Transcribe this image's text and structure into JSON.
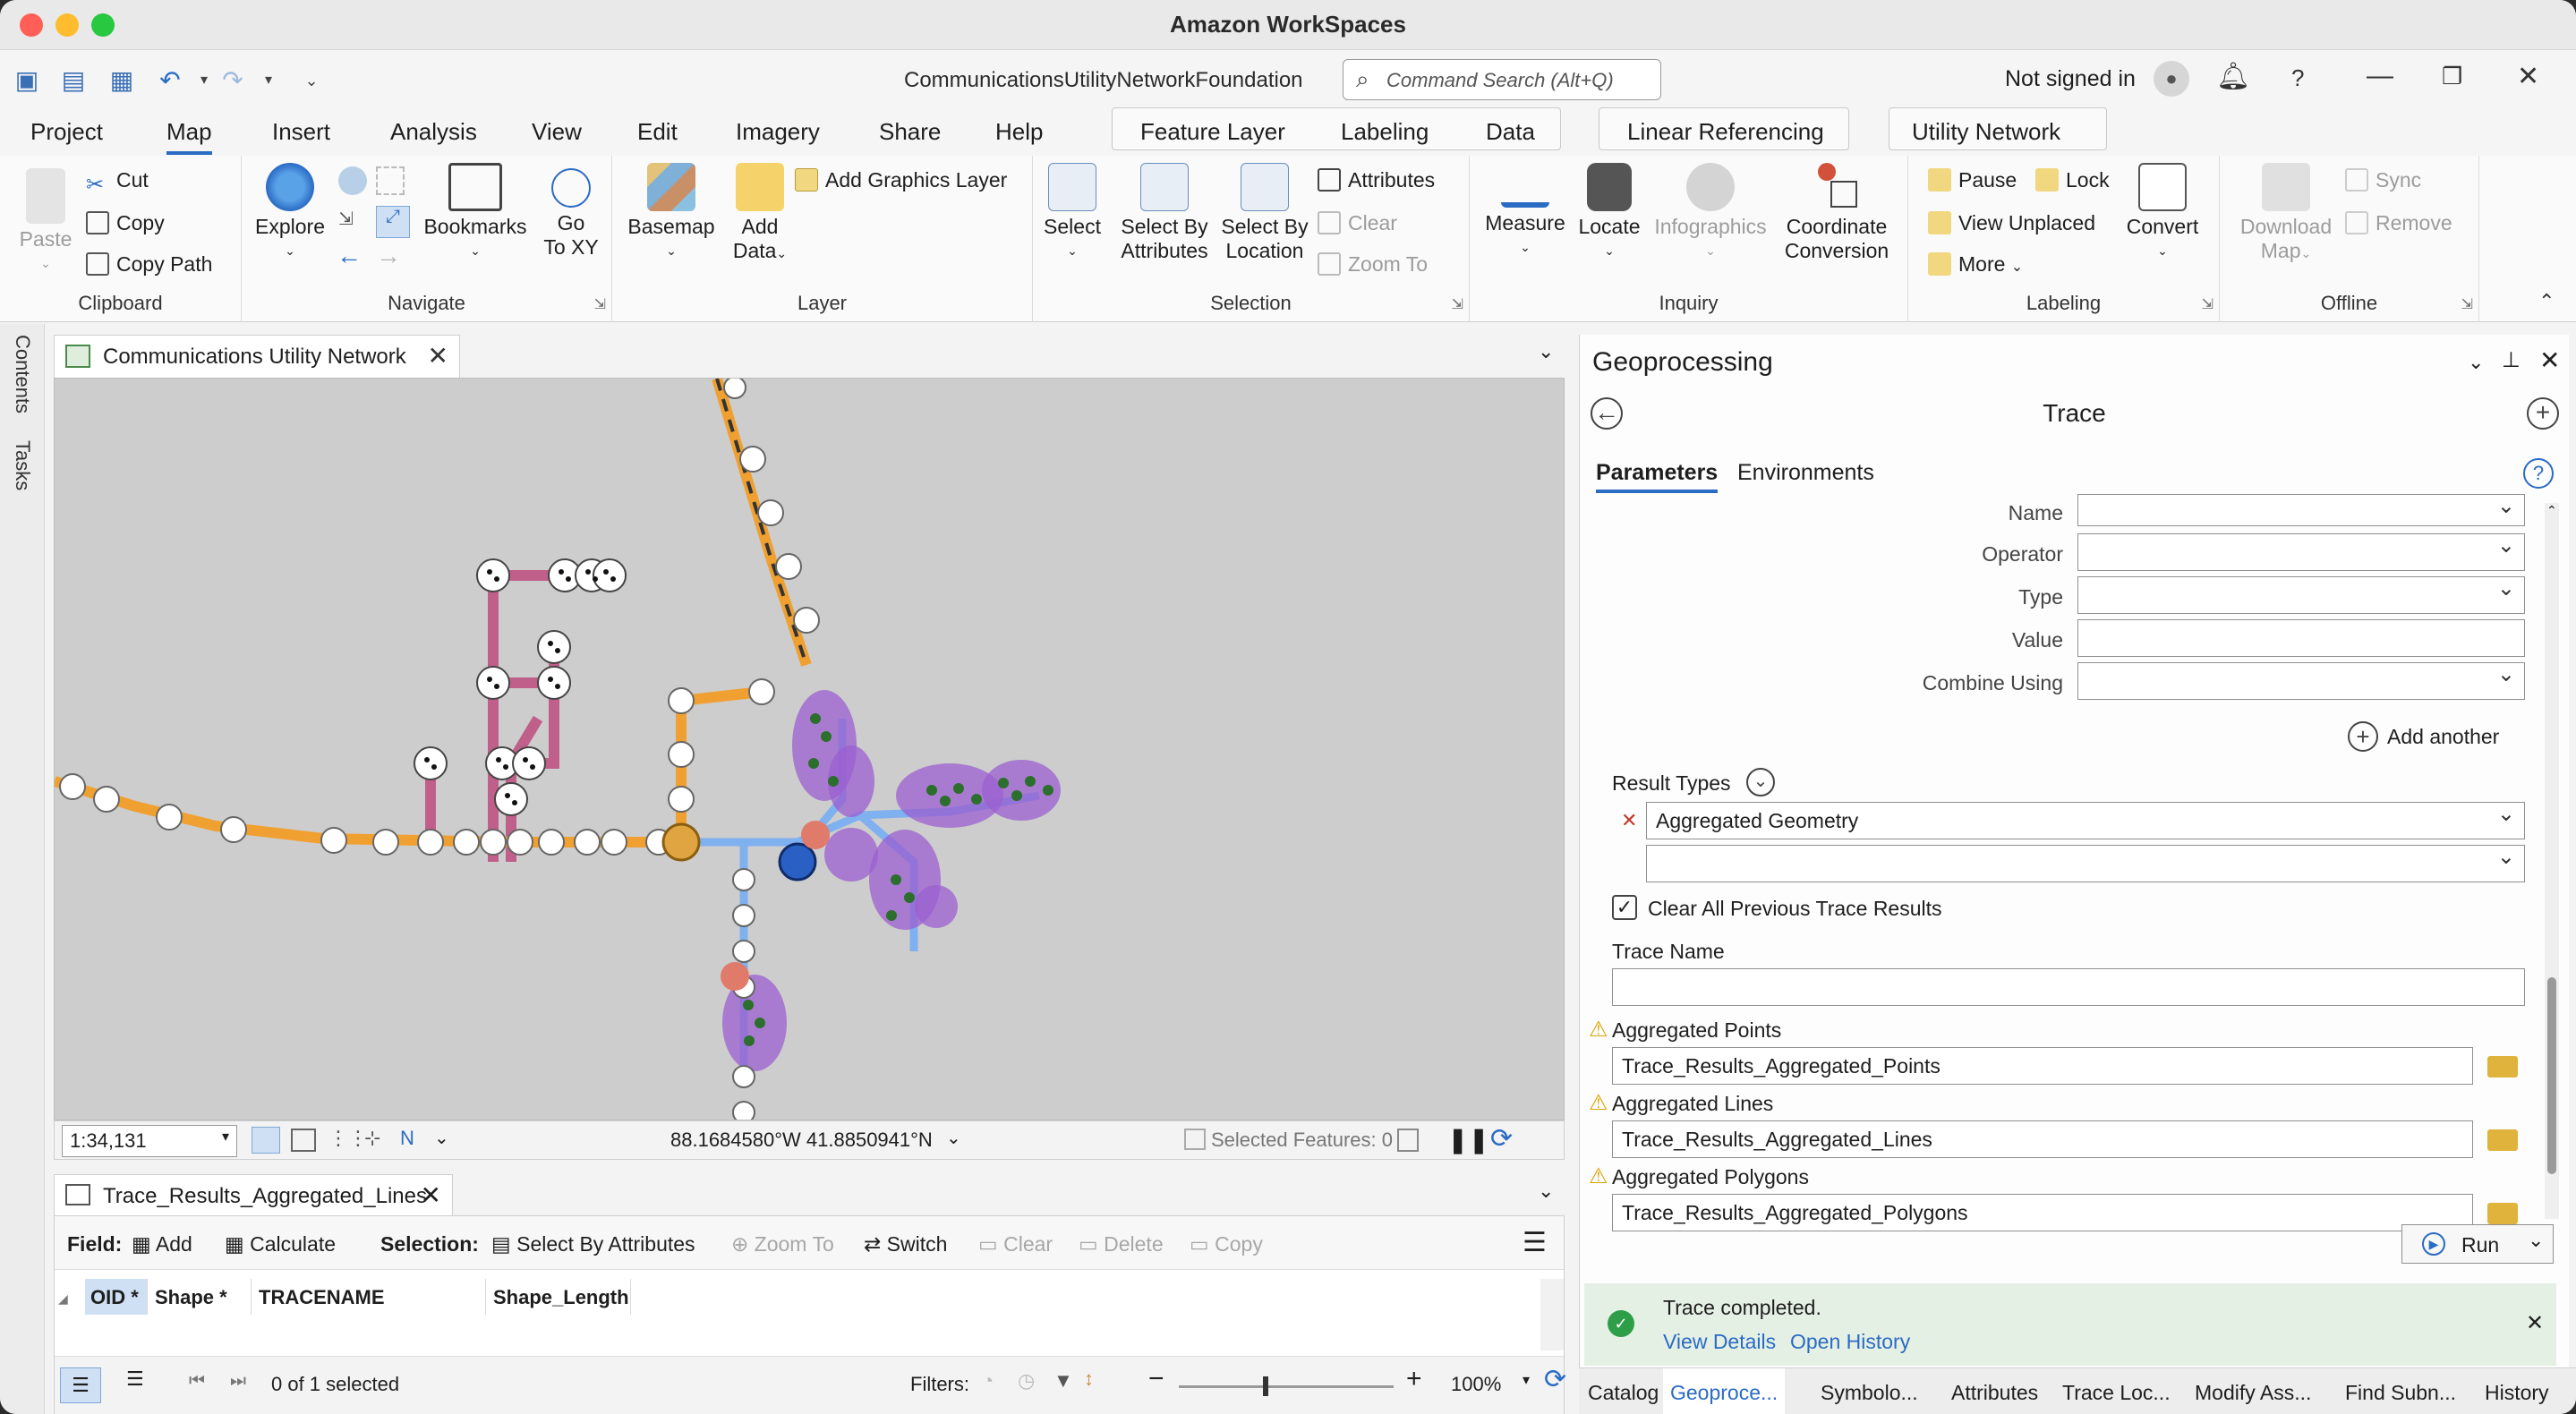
{
  "window": {
    "title": "Amazon WorkSpaces",
    "document_title": "CommunicationsUtilityNetworkFoundation"
  },
  "command_search": {
    "placeholder": "Command Search (Alt+Q)"
  },
  "account": {
    "status": "Not signed in"
  },
  "tabs": [
    "Project",
    "Map",
    "Insert",
    "Analysis",
    "View",
    "Edit",
    "Imagery",
    "Share",
    "Help"
  ],
  "active_tab": "Map",
  "context_tabs": [
    "Feature Layer",
    "Labeling",
    "Data",
    "Linear Referencing",
    "Utility Network"
  ],
  "ribbon": {
    "clipboard": {
      "label": "Clipboard",
      "paste": "Paste",
      "cut": "Cut",
      "copy": "Copy",
      "copy_path": "Copy Path"
    },
    "navigate": {
      "label": "Navigate",
      "explore": "Explore",
      "bookmarks": "Bookmarks",
      "go_to_xy_1": "Go",
      "go_to_xy_2": "To XY"
    },
    "layer": {
      "label": "Layer",
      "basemap": "Basemap",
      "add_data_1": "Add",
      "add_data_2": "Data",
      "add_graphics": "Add Graphics Layer"
    },
    "selection": {
      "label": "Selection",
      "select": "Select",
      "by_attr_1": "Select By",
      "by_attr_2": "Attributes",
      "by_loc_1": "Select By",
      "by_loc_2": "Location",
      "attributes": "Attributes",
      "clear": "Clear",
      "zoom_to": "Zoom To"
    },
    "inquiry": {
      "label": "Inquiry",
      "measure": "Measure",
      "locate": "Locate",
      "infographics": "Infographics",
      "coord_1": "Coordinate",
      "coord_2": "Conversion"
    },
    "labeling": {
      "label": "Labeling",
      "pause": "Pause",
      "lock": "Lock",
      "view_unplaced": "View Unplaced",
      "more": "More",
      "convert": "Convert"
    },
    "offline": {
      "label": "Offline",
      "download_1": "Download",
      "download_2": "Map",
      "sync": "Sync",
      "remove": "Remove"
    }
  },
  "side_tabs": [
    "Contents",
    "Tasks"
  ],
  "map_view": {
    "tab_title": "Communications Utility Network",
    "scale": "1:34,131",
    "coordinates": "88.1684580°W 41.8850941°N",
    "selected_features": "Selected Features: 0"
  },
  "attribute_table": {
    "tab_title": "Trace_Results_Aggregated_Lines",
    "field_label": "Field:",
    "add": "Add",
    "calculate": "Calculate",
    "selection_label": "Selection:",
    "select_by_attributes": "Select By Attributes",
    "zoom_to": "Zoom To",
    "switch": "Switch",
    "clear": "Clear",
    "delete": "Delete",
    "copy": "Copy",
    "columns": [
      "OID *",
      "Shape *",
      "TRACENAME",
      "Shape_Length"
    ],
    "selection_count": "0 of 1 selected",
    "filters_label": "Filters:",
    "zoom_level": "100%"
  },
  "geoprocessing": {
    "pane_title": "Geoprocessing",
    "tool_title": "Trace",
    "tabs": [
      "Parameters",
      "Environments"
    ],
    "filter_fields": [
      "Name",
      "Operator",
      "Type",
      "Value",
      "Combine Using"
    ],
    "add_another": "Add another",
    "result_types_label": "Result Types",
    "result_type_value": "Aggregated Geometry",
    "clear_previous": "Clear All Previous Trace Results",
    "trace_name_label": "Trace Name",
    "outputs": [
      {
        "label": "Aggregated Points",
        "value": "Trace_Results_Aggregated_Points"
      },
      {
        "label": "Aggregated Lines",
        "value": "Trace_Results_Aggregated_Lines"
      },
      {
        "label": "Aggregated Polygons",
        "value": "Trace_Results_Aggregated_Polygons"
      }
    ],
    "run": "Run",
    "status": "Trace completed.",
    "view_details": "View Details",
    "open_history": "Open History"
  },
  "bottom_tabs": [
    "Catalog",
    "Geoproce...",
    "Symbolo...",
    "Attributes",
    "Trace Loc...",
    "Modify Ass...",
    "Find Subn...",
    "History"
  ],
  "colors": {
    "accent": "#2a6bc4",
    "trace_purple": "#9b5fd0",
    "line_orange": "#f0a030",
    "line_pink": "#c0608a",
    "trace_blue": "#7fb0f0"
  }
}
